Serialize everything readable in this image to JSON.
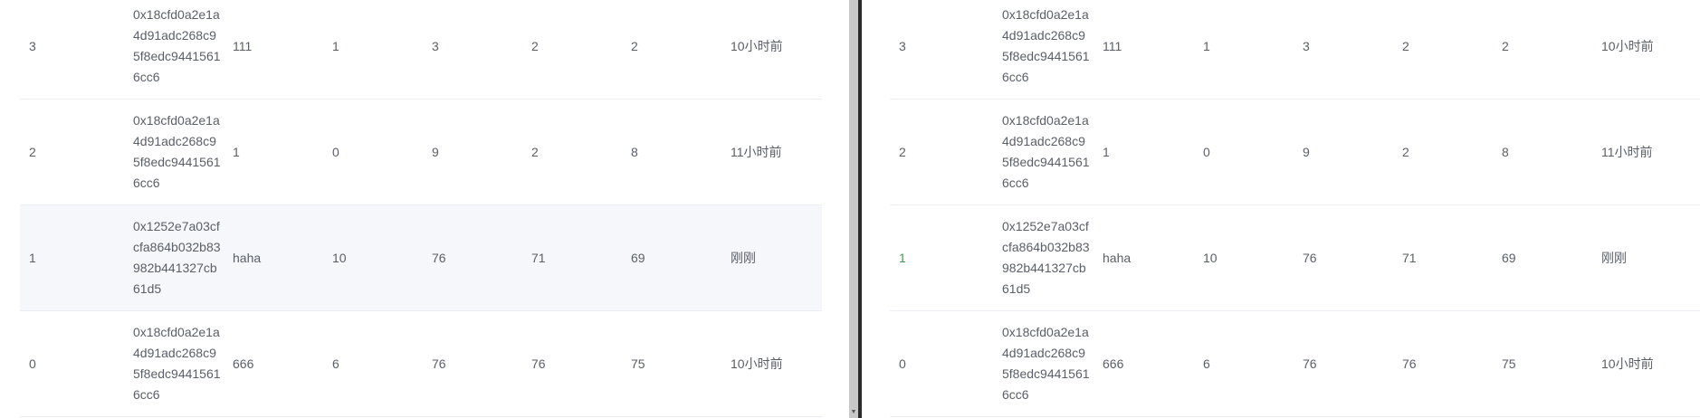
{
  "left_table": {
    "rows": [
      {
        "id": "3",
        "hash": "0x18cfd0a2e1a4d91adc268c95f8edc94415616cc6",
        "name": "111",
        "v1": "1",
        "v2": "3",
        "v3": "2",
        "v4": "2",
        "time": "10小时前"
      },
      {
        "id": "2",
        "hash": "0x18cfd0a2e1a4d91adc268c95f8edc94415616cc6",
        "name": "1",
        "v1": "0",
        "v2": "9",
        "v3": "2",
        "v4": "8",
        "time": "11小时前"
      },
      {
        "id": "1",
        "hash": "0x1252e7a03cfcfa864b032b83982b441327cb61d5",
        "name": "haha",
        "v1": "10",
        "v2": "76",
        "v3": "71",
        "v4": "69",
        "time": "刚刚"
      },
      {
        "id": "0",
        "hash": "0x18cfd0a2e1a4d91adc268c95f8edc94415616cc6",
        "name": "666",
        "v1": "6",
        "v2": "76",
        "v3": "76",
        "v4": "75",
        "time": "10小时前"
      }
    ]
  },
  "right_table": {
    "rows": [
      {
        "id": "3",
        "hash": "0x18cfd0a2e1a4d91adc268c95f8edc94415616cc6",
        "name": "111",
        "v1": "1",
        "v2": "3",
        "v3": "2",
        "v4": "2",
        "time": "10小时前"
      },
      {
        "id": "2",
        "hash": "0x18cfd0a2e1a4d91adc268c95f8edc94415616cc6",
        "name": "1",
        "v1": "0",
        "v2": "9",
        "v3": "2",
        "v4": "8",
        "time": "11小时前"
      },
      {
        "id": "1",
        "hash": "0x1252e7a03cfcfa864b032b83982b441327cb61d5",
        "name": "haha",
        "v1": "10",
        "v2": "76",
        "v3": "71",
        "v4": "69",
        "time": "刚刚"
      },
      {
        "id": "0",
        "hash": "0x18cfd0a2e1a4d91adc268c95f8edc94415616cc6",
        "name": "666",
        "v1": "6",
        "v2": "76",
        "v3": "76",
        "v4": "75",
        "time": "10小时前"
      }
    ]
  },
  "scrollbar": {
    "arrow_icon": "scroll-down-arrow-icon",
    "arrow_glyph": "▼"
  },
  "colors": {
    "text": "#5a5e66",
    "row_border": "#ebeef5",
    "highlight_row": "#f5f7fa",
    "highlight_id_right": "#3c9d52",
    "divider_dark": "#2b2b2b",
    "gutter": "#c8c8c8"
  }
}
